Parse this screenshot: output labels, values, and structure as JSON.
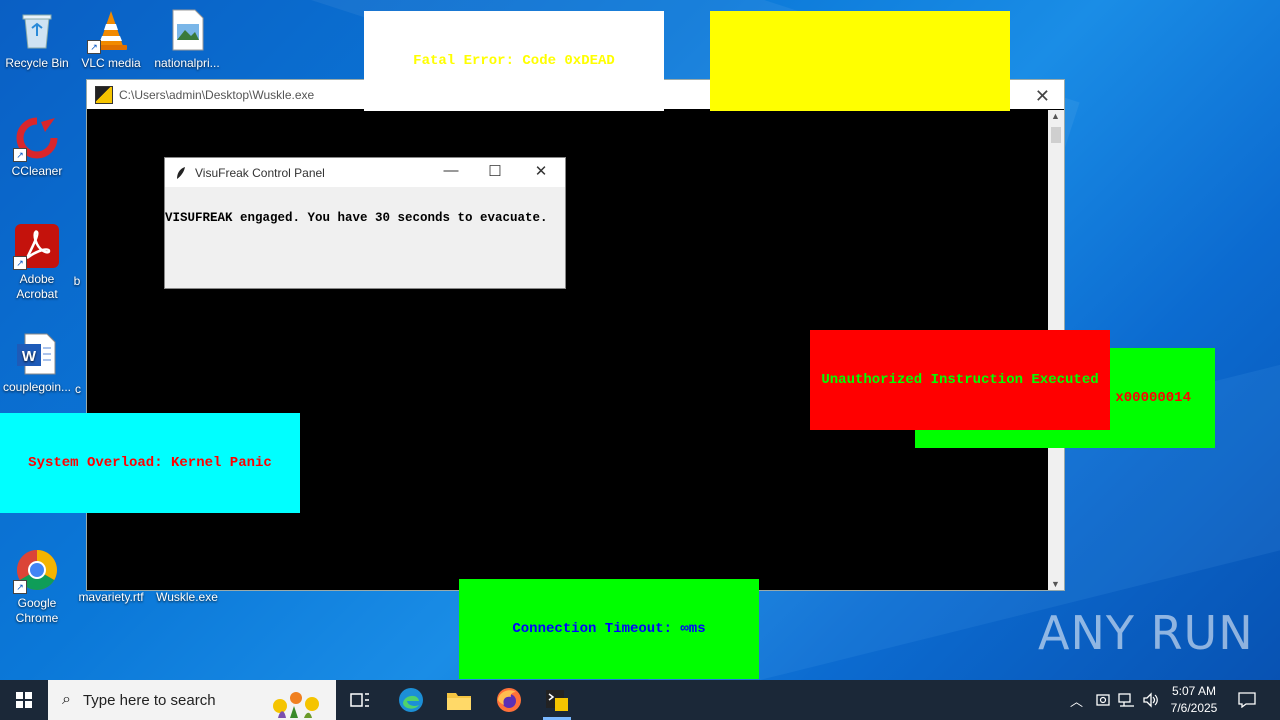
{
  "desktop_icons": [
    {
      "label": "Recycle Bin"
    },
    {
      "label": "VLC media"
    },
    {
      "label": "nationalpri..."
    },
    {
      "label": "CCleaner"
    },
    {
      "label": "Adobe Acrobat"
    },
    {
      "label": "b"
    },
    {
      "label": "couplegoin..."
    },
    {
      "label": "c"
    },
    {
      "label": "Google Chrome"
    },
    {
      "label": "mavariety.rtf"
    },
    {
      "label": "Wuskle.exe"
    }
  ],
  "console_window": {
    "title": "C:\\Users\\admin\\Desktop\\Wuskle.exe"
  },
  "control_panel": {
    "title": "VisuFreak Control Panel",
    "message": "VISUFREAK engaged. You have 30 seconds to evacuate."
  },
  "error_boxes": [
    {
      "text": "Fatal Error: Code 0xDEAD",
      "bg": "#ffffff",
      "fg": "#ffff00"
    },
    {
      "text": "",
      "bg": "#ffff00",
      "fg": "#ffff00"
    },
    {
      "text": "x00000014",
      "bg": "#00ff00",
      "fg": "#ff0000"
    },
    {
      "text": "Unauthorized Instruction Executed",
      "bg": "#ff0000",
      "fg": "#00ff00"
    },
    {
      "text": "System Overload: Kernel Panic",
      "bg": "#00ffff",
      "fg": "#ff0000"
    },
    {
      "text": "Connection Timeout: ∞ms",
      "bg": "#00ff00",
      "fg": "#0000ff"
    }
  ],
  "taskbar": {
    "search_placeholder": "Type here to search",
    "time": "5:07 AM",
    "date": "7/6/2025"
  },
  "watermark": "ANY RUN"
}
